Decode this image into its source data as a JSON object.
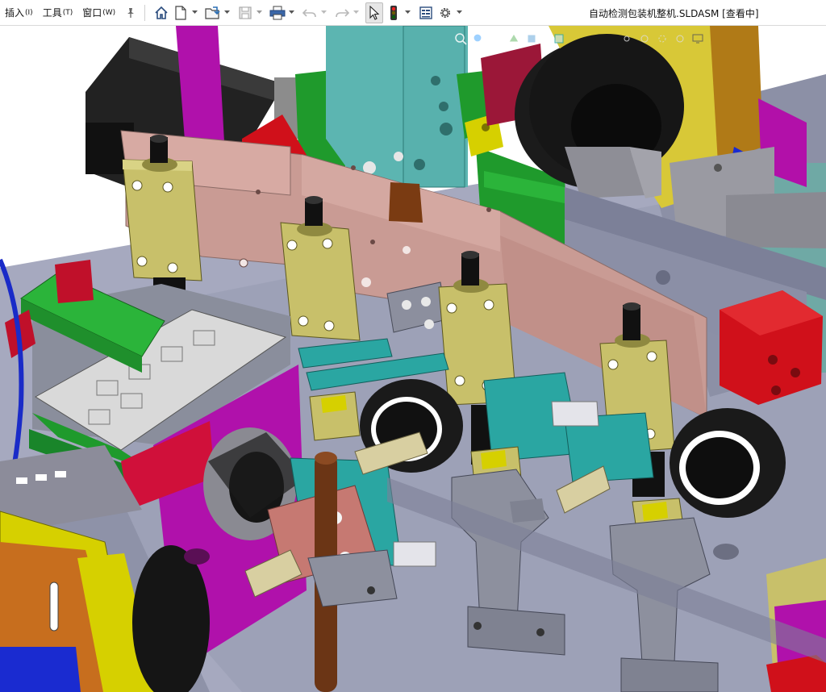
{
  "menu": {
    "insert": "插入",
    "insert_key": "(I)",
    "tools": "工具",
    "tools_key": "(T)",
    "window": "窗口",
    "window_key": "(W)"
  },
  "document": {
    "title": "自动检测包装机整机.SLDASM [查看中]"
  },
  "icons": {
    "toolbar": [
      "pin-icon",
      "home-icon",
      "new-document-icon",
      "open-folder-icon",
      "save-icon",
      "print-icon",
      "undo-icon",
      "redo-icon",
      "select-arrow-icon",
      "traffic-light-icon",
      "file-properties-icon",
      "options-gear-icon"
    ],
    "heads_up": [
      "zoom-to-fit-icon",
      "zoom-area-icon",
      "previous-view-icon",
      "section-view-icon",
      "view-orientation-icon",
      "display-style-icon",
      "hide-show-icon",
      "appearance-icon",
      "scene-icon",
      "view-settings-icon",
      "monitor-icon"
    ]
  },
  "colors": {
    "topbar_bg": "#ffffff",
    "viewport_bg": "#ffffff",
    "frame_gray": "#9fa3b8",
    "plate_pink": "#c99b94",
    "block_olive": "#c8c06a",
    "green": "#1f9a2c",
    "magenta": "#a0129a",
    "teal": "#2aa6a2",
    "red": "#d0101a",
    "yellow": "#d6d000",
    "black": "#111111"
  }
}
